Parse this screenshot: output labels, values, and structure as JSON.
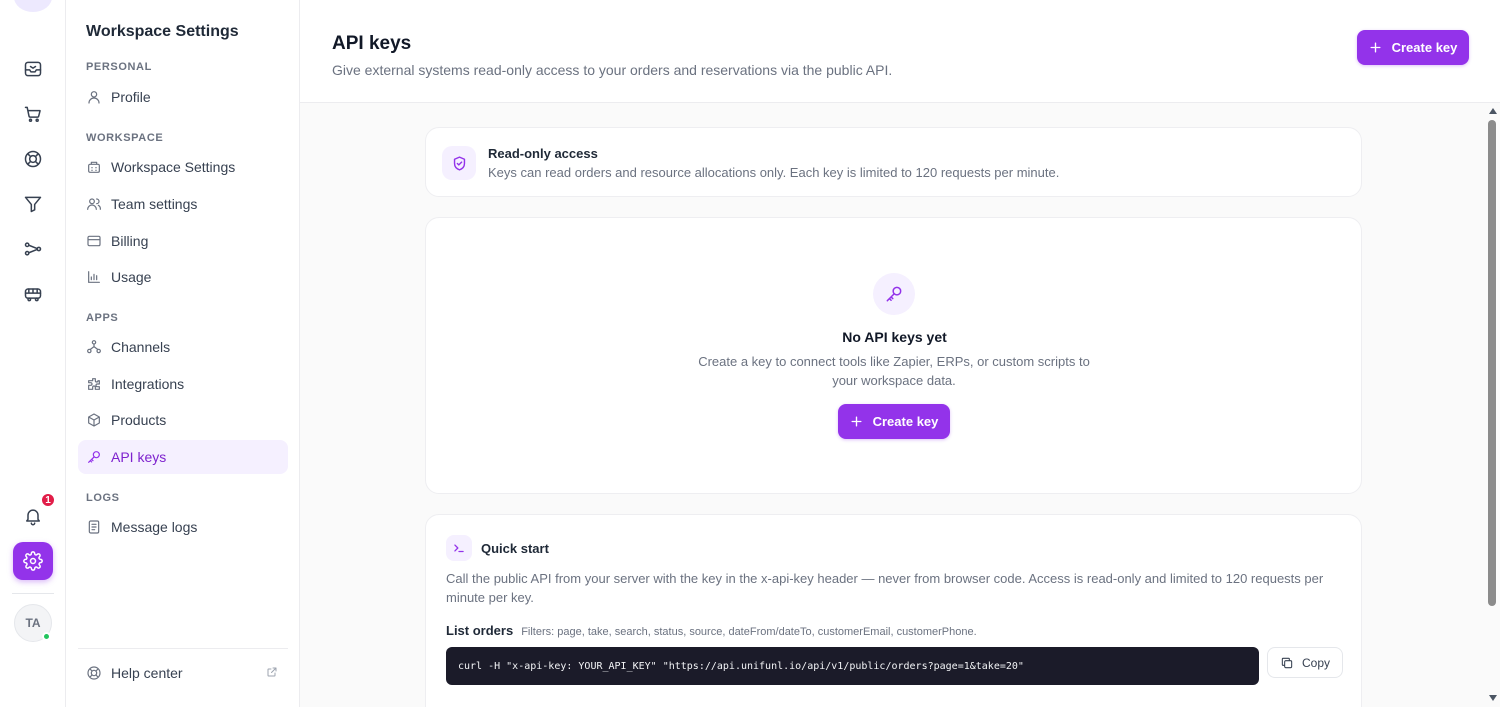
{
  "rail": {
    "icons": [
      "inbox-icon",
      "cart-icon",
      "support-icon",
      "filter-icon",
      "routes-icon",
      "vehicle-icon"
    ],
    "notification_count": "1",
    "avatar_initials": "TA"
  },
  "sidebar": {
    "title": "Workspace Settings",
    "sections": {
      "personal": "PERSONAL",
      "workspace": "WORKSPACE",
      "apps": "APPS",
      "logs": "LOGS"
    },
    "items": {
      "profile": "Profile",
      "workspace_settings": "Workspace Settings",
      "team_settings": "Team settings",
      "billing": "Billing",
      "usage": "Usage",
      "channels": "Channels",
      "integrations": "Integrations",
      "products": "Products",
      "api_keys": "API keys",
      "message_logs": "Message logs",
      "help_center": "Help center"
    },
    "active_item": "API keys"
  },
  "header": {
    "title": "API keys",
    "subtitle": "Give external systems read-only access to your orders and reservations via the public API.",
    "create_button": "Create key"
  },
  "info": {
    "title": "Read-only access",
    "text": "Keys can read orders and resource allocations only. Each key is limited to 120 requests per minute."
  },
  "empty": {
    "title": "No API keys yet",
    "text": "Create a key to connect tools like Zapier, ERPs, or custom scripts to your workspace data.",
    "button": "Create key"
  },
  "quick_start": {
    "title": "Quick start",
    "description": "Call the public API from your server with the key in the x-api-key header — never from browser code. Access is read-only and limited to 120 requests per minute per key.",
    "list_orders": {
      "label": "List orders",
      "filters": "Filters: page, take, search, status, source, dateFrom/dateTo, customerEmail, customerPhone.",
      "code": "curl -H \"x-api-key: YOUR_API_KEY\" \"https://api.unifunl.io/api/v1/public/orders?page=1&take=20\"",
      "copy": "Copy"
    }
  },
  "colors": {
    "accent": "#9333ea",
    "accent_soft": "#f5f0ff",
    "badge": "#e11d48",
    "online": "#22c55e",
    "code_bg": "#1b1b29"
  }
}
